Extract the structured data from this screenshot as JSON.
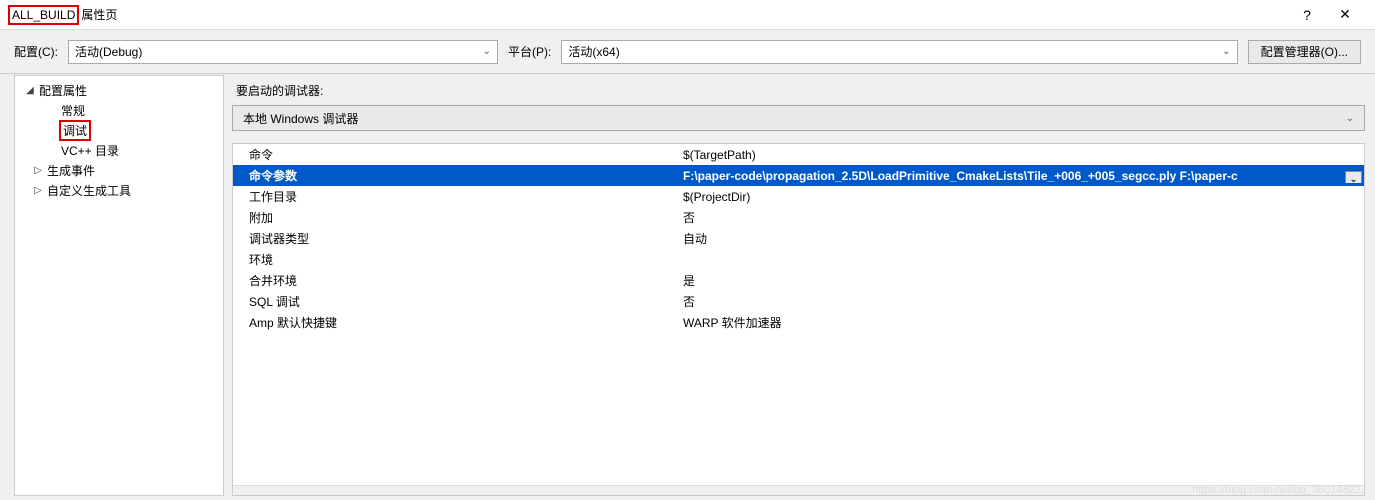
{
  "titlebar": {
    "title_prefix": "ALL_BUILD",
    "title_suffix": "属性页",
    "help_icon": "?",
    "close_icon": "✕"
  },
  "toolbar": {
    "config_label": "配置(C):",
    "config_value": "活动(Debug)",
    "platform_label": "平台(P):",
    "platform_value": "活动(x64)",
    "manager_button": "配置管理器(O)..."
  },
  "tree": {
    "root": "配置属性",
    "items": [
      {
        "label": "常规",
        "indent": "indent1"
      },
      {
        "label": "调试",
        "indent": "indent1",
        "selected": true
      },
      {
        "label": "VC++ 目录",
        "indent": "indent1"
      },
      {
        "label": "生成事件",
        "indent": "indent1e",
        "expander": "▷"
      },
      {
        "label": "自定义生成工具",
        "indent": "indent1e",
        "expander": "▷"
      }
    ]
  },
  "main": {
    "launch_label": "要启动的调试器:",
    "debugger_value": "本地 Windows 调试器"
  },
  "grid": {
    "rows": [
      {
        "label": "命令",
        "value": "$(TargetPath)"
      },
      {
        "label": "命令参数",
        "value_prefix": "F:\\paper-code\\propagation_2.5D\\LoadPrimitive_CmakeLists\\",
        "value_underlined": "Tile_+006_+005_segcc.ply",
        "value_suffix": " F:\\paper-c",
        "selected": true
      },
      {
        "label": "工作目录",
        "value": "$(ProjectDir)"
      },
      {
        "label": "附加",
        "value": "否"
      },
      {
        "label": "调试器类型",
        "value": "自动"
      },
      {
        "label": "环境",
        "value": ""
      },
      {
        "label": "合并环境",
        "value": "是"
      },
      {
        "label": "SQL 调试",
        "value": "否"
      },
      {
        "label": "Amp 默认快捷键",
        "value": "WARP 软件加速器"
      }
    ]
  },
  "watermark": "https://blog.csdn.net/qq_38014822"
}
